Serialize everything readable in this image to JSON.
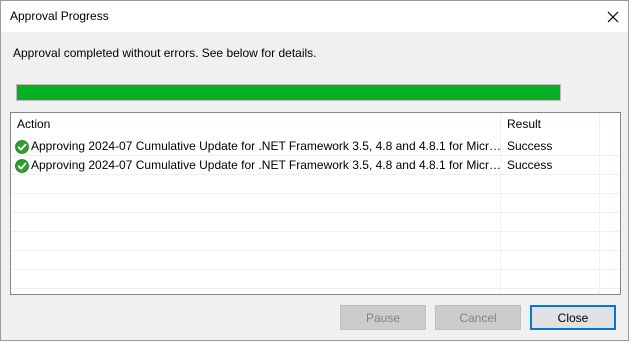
{
  "window": {
    "title": "Approval Progress",
    "close_glyph": "close-icon"
  },
  "message": "Approval completed without errors. See below for details.",
  "progress": {
    "percent": 100,
    "color": "#06b025"
  },
  "table": {
    "columns": [
      "Action",
      "Result"
    ],
    "rows": [
      {
        "icon": "success-check-icon",
        "action": "Approving 2024-07 Cumulative Update for .NET Framework 3.5, 4.8 and 4.8.1 for Micro...",
        "result": "Success"
      },
      {
        "icon": "success-check-icon",
        "action": "Approving 2024-07 Cumulative Update for .NET Framework 3.5, 4.8 and 4.8.1 for Micro...",
        "result": "Success"
      }
    ]
  },
  "buttons": {
    "pause": "Pause",
    "cancel": "Cancel",
    "close": "Close"
  },
  "colors": {
    "accent": "#0078d7",
    "success": "#2f9e2f"
  }
}
